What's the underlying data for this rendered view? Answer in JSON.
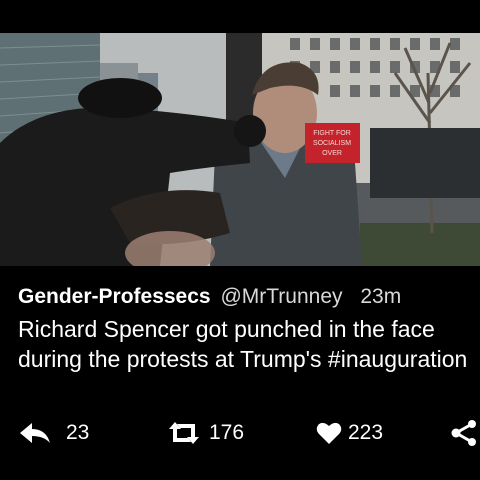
{
  "tweet": {
    "author": {
      "display_name": "Gender-Professecs",
      "handle": "@MrTrunney"
    },
    "timestamp": "23m",
    "text": "Richard Spencer got punched in the face during the protests at Trump's #inauguration",
    "media": {
      "sign_text": [
        "FIGHT FOR",
        "SOCIALISM",
        "OVER"
      ]
    },
    "actions": {
      "reply": {
        "icon": "reply-icon",
        "count": "23"
      },
      "retweet": {
        "icon": "retweet-icon",
        "count": "176"
      },
      "like": {
        "icon": "heart-icon",
        "count": "223"
      },
      "share": {
        "icon": "share-icon"
      }
    }
  },
  "colors": {
    "background": "#000000",
    "text": "#ffffff",
    "secondary_text": "#d9d9d9",
    "sign_red": "#c4232b"
  }
}
